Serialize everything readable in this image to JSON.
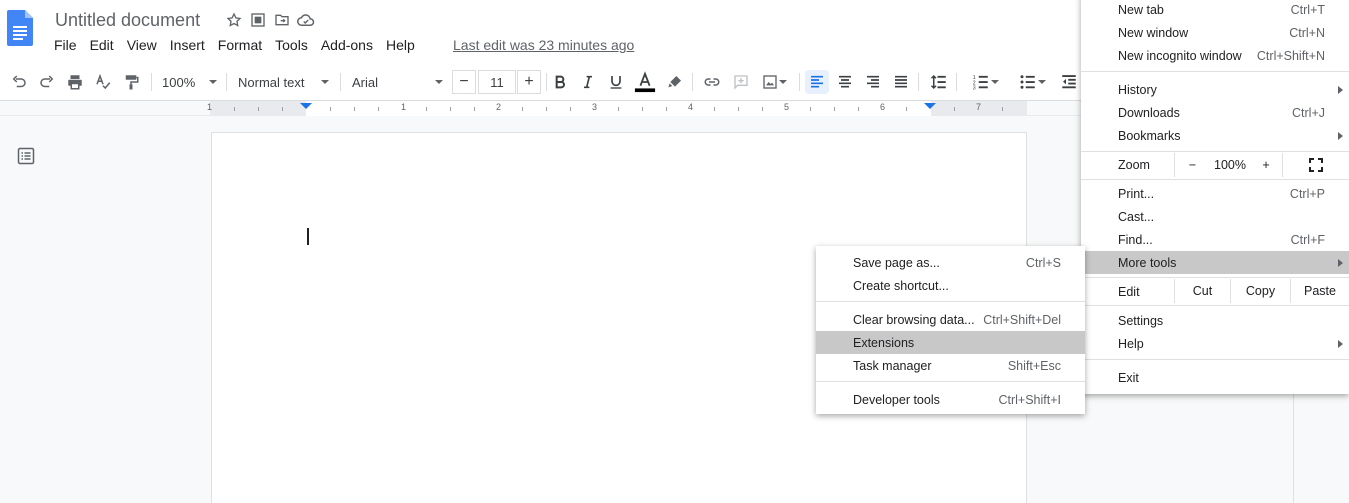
{
  "docs": {
    "title": "Untitled document",
    "menus": [
      "File",
      "Edit",
      "View",
      "Insert",
      "Format",
      "Tools",
      "Add-ons",
      "Help"
    ],
    "last_edit": "Last edit was 23 minutes ago"
  },
  "toolbar": {
    "zoom": "100%",
    "style": "Normal text",
    "font": "Arial",
    "font_size": "11",
    "minus": "−",
    "plus": "+"
  },
  "ruler": {
    "numbers": [
      "1",
      "1",
      "2",
      "3",
      "4",
      "5",
      "6",
      "7"
    ]
  },
  "chrome_menu": {
    "new_tab": "New tab",
    "new_tab_sc": "Ctrl+T",
    "new_window": "New window",
    "new_window_sc": "Ctrl+N",
    "incognito": "New incognito window",
    "incognito_sc": "Ctrl+Shift+N",
    "history": "History",
    "downloads": "Downloads",
    "downloads_sc": "Ctrl+J",
    "bookmarks": "Bookmarks",
    "zoom_label": "Zoom",
    "zoom_minus": "−",
    "zoom_value": "100%",
    "zoom_plus": "+",
    "print": "Print...",
    "print_sc": "Ctrl+P",
    "cast": "Cast...",
    "find": "Find...",
    "find_sc": "Ctrl+F",
    "more_tools": "More tools",
    "edit_label": "Edit",
    "cut": "Cut",
    "copy": "Copy",
    "paste": "Paste",
    "settings": "Settings",
    "help": "Help",
    "exit": "Exit"
  },
  "more_tools_menu": {
    "save_page": "Save page as...",
    "save_page_sc": "Ctrl+S",
    "create_shortcut": "Create shortcut...",
    "clear_data": "Clear browsing data...",
    "clear_data_sc": "Ctrl+Shift+Del",
    "extensions": "Extensions",
    "task_manager": "Task manager",
    "task_manager_sc": "Shift+Esc",
    "dev_tools": "Developer tools",
    "dev_tools_sc": "Ctrl+Shift+I"
  },
  "colors": {
    "docs_blue": "#4285f4",
    "accent_blue": "#1a73e8",
    "highlight_gray": "#c8c8c8"
  }
}
